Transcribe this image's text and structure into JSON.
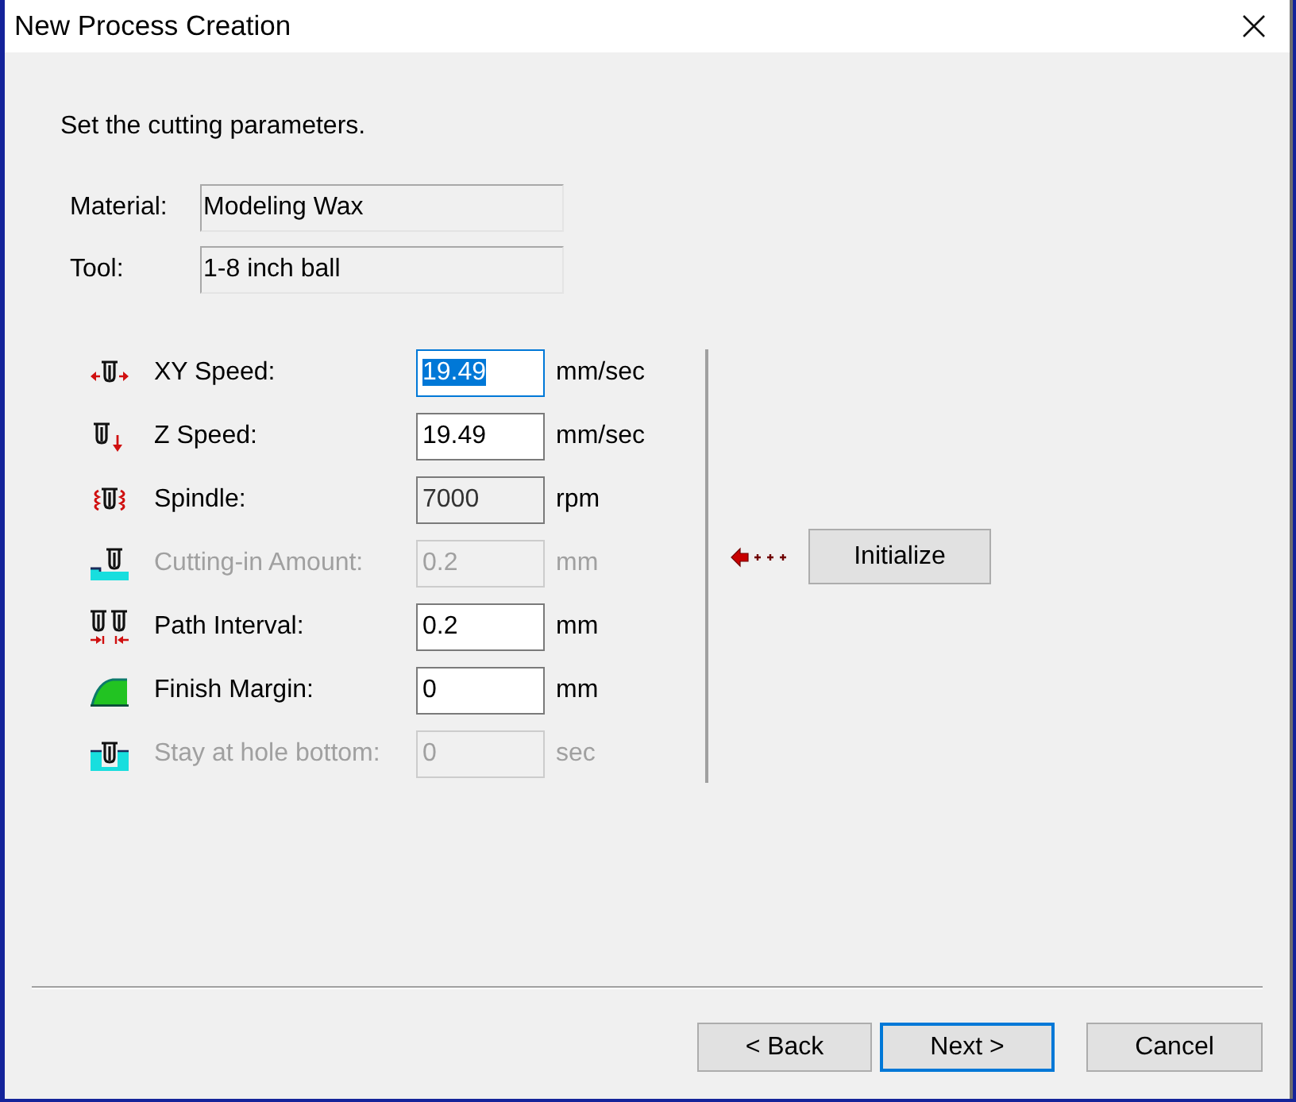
{
  "window": {
    "title": "New Process Creation"
  },
  "instruction": "Set the cutting parameters.",
  "info_fields": [
    {
      "label": "Material:",
      "value": "Modeling Wax"
    },
    {
      "label": "Tool:",
      "value": "1-8 inch ball"
    }
  ],
  "parameters": [
    {
      "label": "XY Speed:",
      "value": "19.49",
      "unit": "mm/sec",
      "focused": true,
      "read_only": false,
      "disabled": false
    },
    {
      "label": "Z Speed:",
      "value": "19.49",
      "unit": "mm/sec",
      "focused": false,
      "read_only": false,
      "disabled": false
    },
    {
      "label": "Spindle:",
      "value": "7000",
      "unit": "rpm",
      "focused": false,
      "read_only": true,
      "disabled": false
    },
    {
      "label": "Cutting-in Amount:",
      "value": "0.2",
      "unit": "mm",
      "focused": false,
      "read_only": false,
      "disabled": true
    },
    {
      "label": "Path Interval:",
      "value": "0.2",
      "unit": "mm",
      "focused": false,
      "read_only": false,
      "disabled": false
    },
    {
      "label": "Finish Margin:",
      "value": "0",
      "unit": "mm",
      "focused": false,
      "read_only": false,
      "disabled": false
    },
    {
      "label": "Stay at hole bottom:",
      "value": "0",
      "unit": "sec",
      "focused": false,
      "read_only": false,
      "disabled": true
    }
  ],
  "initialize_button": {
    "label": "Initialize"
  },
  "buttons": [
    {
      "label": "< Back",
      "default": false
    },
    {
      "label": "Next >",
      "default": true
    },
    {
      "label": "Cancel",
      "default": false
    }
  ]
}
